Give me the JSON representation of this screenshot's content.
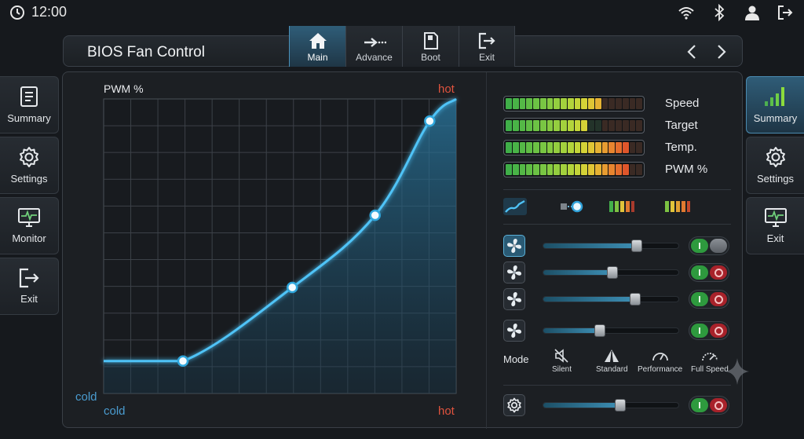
{
  "status": {
    "time": "12:00"
  },
  "app": {
    "title": "BIOS Fan Control"
  },
  "tabs": [
    {
      "label": "Main",
      "icon": "home-icon",
      "active": true
    },
    {
      "label": "Advance",
      "icon": "arrow-right-icon",
      "active": false
    },
    {
      "label": "Boot",
      "icon": "boot-icon",
      "active": false
    },
    {
      "label": "Exit",
      "icon": "exit-icon",
      "active": false
    }
  ],
  "left_menu": [
    {
      "label": "Summary",
      "icon": "document-icon"
    },
    {
      "label": "Settings",
      "icon": "gear-icon"
    },
    {
      "label": "Monitor",
      "icon": "monitor-icon"
    },
    {
      "label": "Exit",
      "icon": "exit-icon"
    }
  ],
  "right_menu": [
    {
      "label": "Summary",
      "icon": "signal-bars-icon",
      "active": true
    },
    {
      "label": "Settings",
      "icon": "gear-icon",
      "active": false
    },
    {
      "label": "Exit",
      "icon": "monitor-icon",
      "active": false
    }
  ],
  "chart_data": {
    "type": "line",
    "ylabel": "PWM %",
    "y_top_label": "hot",
    "y_bottom_label": "cold",
    "x_left_label": "cold",
    "x_right_label": "hot",
    "xlim": [
      0,
      100
    ],
    "ylim": [
      0,
      100
    ],
    "grid": true,
    "series": [
      {
        "x": [
          0,
          22.5,
          53.5,
          77,
          92.5,
          100
        ],
        "y": [
          11,
          11,
          36,
          60.5,
          92.5,
          100
        ]
      }
    ],
    "control_points": {
      "x": [
        22.5,
        53.5,
        77,
        92.5
      ],
      "y": [
        11,
        36,
        60.5,
        92.5
      ]
    },
    "colors": {
      "line": "#4fc3f7",
      "fill": "#1f5a7a"
    }
  },
  "meters": [
    {
      "label": "Speed",
      "level": 0.69
    },
    {
      "label": "Target",
      "level": 0.58
    },
    {
      "label": "Temp.",
      "level": 0.9
    },
    {
      "label": "PWM %",
      "level": 0.9
    }
  ],
  "view_icons": [
    "curve-icon",
    "fan-slider-icon",
    "bar-meter-icon",
    "bar-meter-icon"
  ],
  "fans": [
    {
      "level": 0.69,
      "enabled": true,
      "active": true
    },
    {
      "level": 0.51,
      "enabled": true,
      "active": false
    },
    {
      "level": 0.68,
      "enabled": true,
      "active": false
    },
    {
      "level": 0.42,
      "enabled": true,
      "active": false
    }
  ],
  "mode": {
    "label": "Mode",
    "options": [
      {
        "label": "Silent",
        "icon": "mute-icon"
      },
      {
        "label": "Standard",
        "icon": "standard-icon"
      },
      {
        "label": "Performance",
        "icon": "gauge-icon"
      },
      {
        "label": "Full Speed",
        "icon": "gauge-full-icon"
      }
    ]
  },
  "master": {
    "level": 0.57,
    "enabled": true
  }
}
